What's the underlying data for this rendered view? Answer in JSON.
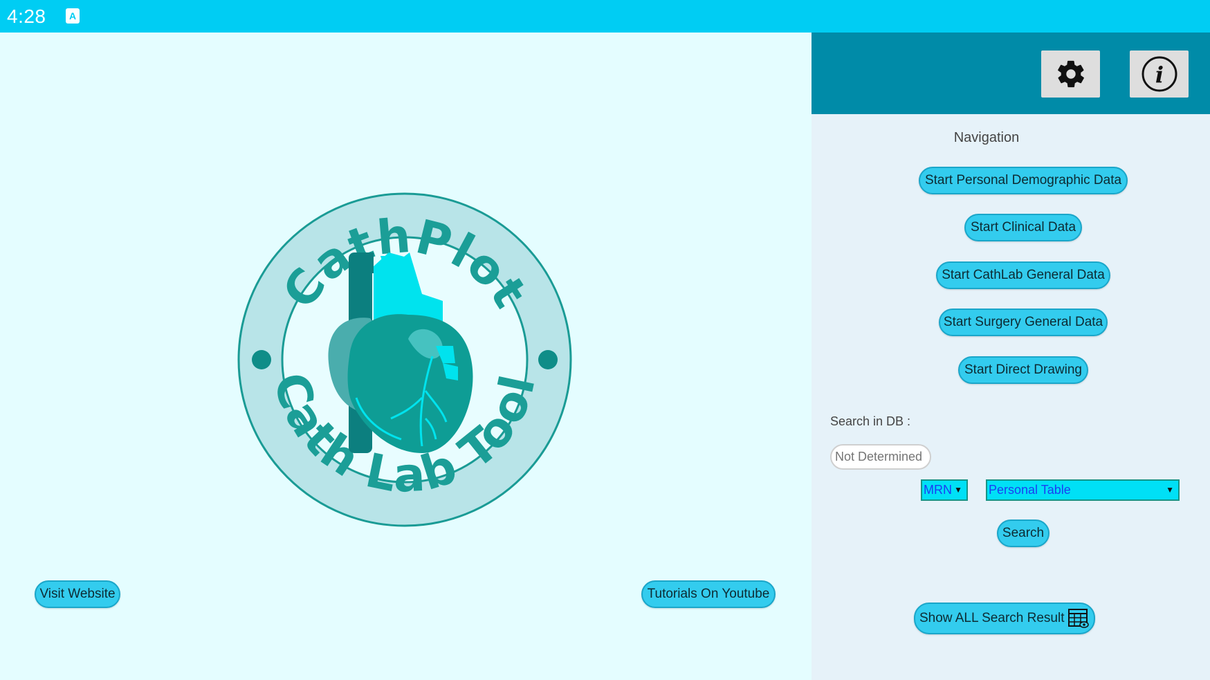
{
  "statusbar": {
    "time": "4:28",
    "notif_icon": "app-notification-icon"
  },
  "logo": {
    "top_text": "CathPlot",
    "bottom_text": "Cath Lab Tool"
  },
  "left": {
    "visit_website_label": "Visit Website",
    "tutorials_label": "Tutorials On Youtube"
  },
  "header": {
    "settings_icon": "gear-icon",
    "info_icon": "info-icon"
  },
  "navigation": {
    "title": "Navigation",
    "items": [
      {
        "label": "Start Personal Demographic Data"
      },
      {
        "label": "Start Clinical Data"
      },
      {
        "label": "Start CathLab General Data"
      },
      {
        "label": "Start Surgery General Data"
      },
      {
        "label": "Start Direct Drawing"
      }
    ]
  },
  "search": {
    "label": "Search in DB :",
    "input_placeholder": "Not Determined",
    "field_select": "MRN",
    "table_select": "Personal Table",
    "search_label": "Search",
    "show_all_label": "Show ALL Search Result",
    "show_all_icon": "table-view-icon"
  },
  "colors": {
    "status_bar": "#00cdf3",
    "header": "#008ba8",
    "button": "#33ccee",
    "logo_teal": "#1a9b95"
  }
}
